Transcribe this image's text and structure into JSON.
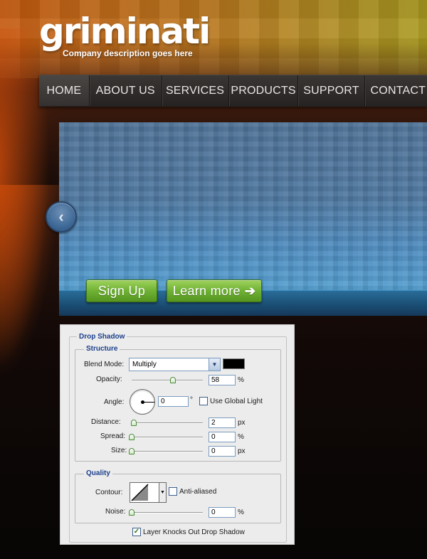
{
  "header": {
    "logo_text": "griminati",
    "tagline": "Company description goes here"
  },
  "nav": {
    "items": [
      "HOME",
      "ABOUT US",
      "SERVICES",
      "PRODUCTS",
      "SUPPORT",
      "CONTACT"
    ],
    "active": "HOME"
  },
  "slider": {
    "prev_icon": "chevron-left-icon",
    "signup_label": "Sign Up",
    "learn_more_label": "Learn more",
    "learn_more_icon": "arrow-right-icon"
  },
  "panel": {
    "title": "Drop Shadow",
    "structure": {
      "legend": "Structure",
      "blend_mode_label": "Blend Mode:",
      "blend_mode_value": "Multiply",
      "shadow_color": "#000000",
      "opacity_label": "Opacity:",
      "opacity_value": "58",
      "opacity_unit": "%",
      "angle_label": "Angle:",
      "angle_value": "0",
      "angle_unit": "°",
      "use_global_light_label": "Use Global Light",
      "use_global_light_checked": false,
      "distance_label": "Distance:",
      "distance_value": "2",
      "distance_unit": "px",
      "spread_label": "Spread:",
      "spread_value": "0",
      "spread_unit": "%",
      "size_label": "Size:",
      "size_value": "0",
      "size_unit": "px"
    },
    "quality": {
      "legend": "Quality",
      "contour_label": "Contour:",
      "anti_aliased_label": "Anti-aliased",
      "anti_aliased_checked": false,
      "noise_label": "Noise:",
      "noise_value": "0",
      "noise_unit": "%"
    },
    "layer_knocks_out_label": "Layer Knocks Out Drop Shadow",
    "layer_knocks_out_checked": true
  },
  "colors": {
    "accent_green": "#6fb234",
    "nav_bg": "#2e2a29",
    "slider_blue": "#4f78a0",
    "panel_legend_blue": "#1b3f8c"
  }
}
